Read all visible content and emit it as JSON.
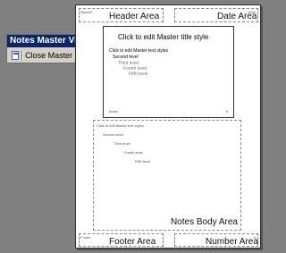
{
  "toolbar": {
    "title": "Notes Master View",
    "close_label": "Close Master View"
  },
  "page": {
    "header_small": "Header",
    "header_area": "Header Area",
    "date_small": "Date",
    "date_area": "Date Area",
    "footer_small": "Footer",
    "footer_area": "Footer Area",
    "number_small": "#",
    "number_area": "Number Area",
    "notes_area": "Notes Body Area"
  },
  "slide": {
    "title": "Click to edit Master title style",
    "lines": [
      "Click to edit Master text styles",
      "Second level",
      "Third level",
      "Fourth level",
      "Fifth level"
    ],
    "footer_left": "footer",
    "footer_right": "#"
  },
  "notes_lines": [
    "Click to edit Master text styles",
    "Second level",
    "Third level",
    "Fourth level",
    "Fifth level"
  ],
  "colors": {
    "background": "#808080",
    "toolbar_title_bar": "#0a246a",
    "toolbar_face": "#d4d0c8"
  }
}
